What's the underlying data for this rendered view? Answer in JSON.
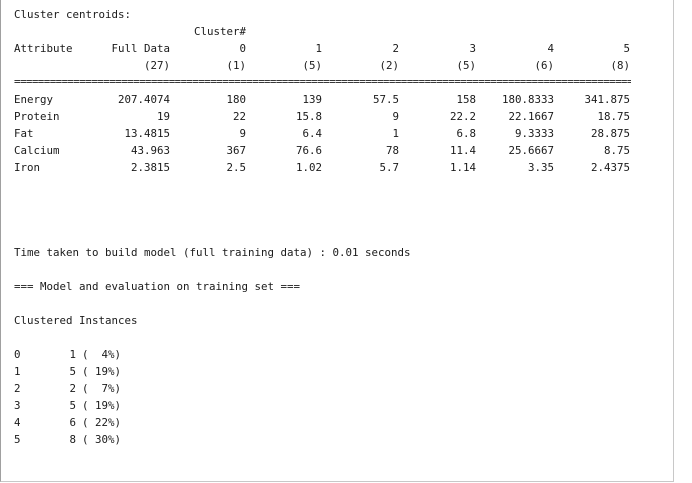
{
  "heading": "Cluster centroids:",
  "cluster_header": "Cluster#",
  "columns": [
    {
      "label": "Full Data",
      "size": "(27)"
    },
    {
      "label": "0",
      "size": "(1)"
    },
    {
      "label": "1",
      "size": "(5)"
    },
    {
      "label": "2",
      "size": "(2)"
    },
    {
      "label": "3",
      "size": "(5)"
    },
    {
      "label": "4",
      "size": "(6)"
    },
    {
      "label": "5",
      "size": "(8)"
    }
  ],
  "attribute_header": "Attribute",
  "separator": "==========================================================================================================",
  "rows": [
    {
      "attribute": "Energy",
      "values": [
        "207.4074",
        "180",
        "139",
        "57.5",
        "158",
        "180.8333",
        "341.875"
      ]
    },
    {
      "attribute": "Protein",
      "values": [
        "19",
        "22",
        "15.8",
        "9",
        "22.2",
        "22.1667",
        "18.75"
      ]
    },
    {
      "attribute": "Fat",
      "values": [
        "13.4815",
        "9",
        "6.4",
        "1",
        "6.8",
        "9.3333",
        "28.875"
      ]
    },
    {
      "attribute": "Calcium",
      "values": [
        "43.963",
        "367",
        "76.6",
        "78",
        "11.4",
        "25.6667",
        "8.75"
      ]
    },
    {
      "attribute": "Iron",
      "values": [
        "2.3815",
        "2.5",
        "1.02",
        "5.7",
        "1.14",
        "3.35",
        "2.4375"
      ]
    }
  ],
  "time_taken": "Time taken to build model (full training data) : 0.01 seconds",
  "eval_header": "=== Model and evaluation on training set ===",
  "clustered_title": "Clustered Instances",
  "distribution": [
    {
      "cluster": "0",
      "count": "1",
      "pct": "(  4%)"
    },
    {
      "cluster": "1",
      "count": "5",
      "pct": "( 19%)"
    },
    {
      "cluster": "2",
      "count": "2",
      "pct": "(  7%)"
    },
    {
      "cluster": "3",
      "count": "5",
      "pct": "( 19%)"
    },
    {
      "cluster": "4",
      "count": "6",
      "pct": "( 22%)"
    },
    {
      "cluster": "5",
      "count": "8",
      "pct": "( 30%)"
    }
  ]
}
